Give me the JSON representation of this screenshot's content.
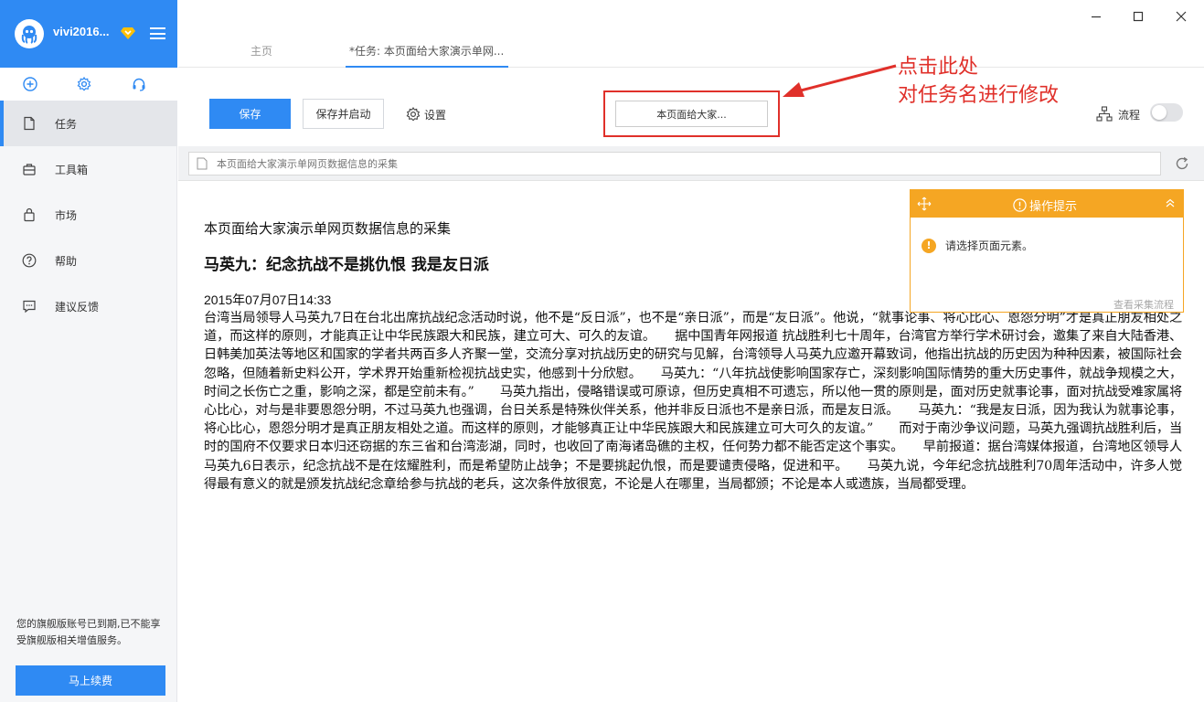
{
  "user": {
    "name": "vivi2016..."
  },
  "sidebar": {
    "quick_icons": [
      "add-circle-icon",
      "gear-icon",
      "headset-icon"
    ],
    "items": [
      {
        "label": "任务",
        "icon": "document-icon",
        "active": true
      },
      {
        "label": "工具箱",
        "icon": "toolbox-icon",
        "active": false
      },
      {
        "label": "市场",
        "icon": "bag-icon",
        "active": false
      },
      {
        "label": "帮助",
        "icon": "help-icon",
        "active": false
      },
      {
        "label": "建议反馈",
        "icon": "feedback-icon",
        "active": false
      }
    ],
    "expire_notice": "您的旗舰版账号已到期,已不能享受旗舰版相关增值服务。",
    "renew_label": "马上续费"
  },
  "tabs": [
    {
      "label": "主页",
      "active": false
    },
    {
      "label": "*任务: 本页面给大家演示单网...",
      "active": true
    }
  ],
  "toolbar": {
    "save_label": "保存",
    "save_start_label": "保存并启动",
    "settings_label": "设置",
    "task_name": "本页面给大家...",
    "flow_label": "流程"
  },
  "annotation": {
    "line1": "点击此处",
    "line2": "对任务名进行修改",
    "color": "#e0302a"
  },
  "urlbar": {
    "placeholder": "本页面给大家演示单网页数据信息的采集"
  },
  "tip": {
    "title": "操作提示",
    "message": "请选择页面元素。",
    "link": "查看采集流程"
  },
  "page": {
    "subtitle": "本页面给大家演示单网页数据信息的采集",
    "title": "马英九：纪念抗战不是挑仇恨 我是友日派",
    "date": "2015年07月07日14:33",
    "body": "台湾当局领导人马英九7日在台北出席抗战纪念活动时说，他不是“反日派”，也不是“亲日派”，而是“友日派”。他说，“就事论事、将心比心、恩怨分明”才是真正朋友相处之道，而这样的原则，才能真正让中华民族跟大和民族，建立可大、可久的友谊。　　据中国青年网报道 抗战胜利七十周年，台湾官方举行学术研讨会，邀集了来自大陆香港、日韩美加英法等地区和国家的学者共两百多人齐聚一堂，交流分享对抗战历史的研究与见解，台湾领导人马英九应邀开幕致词，他指出抗战的历史因为种种因素，被国际社会忽略，但随着新史料公开，学术界开始重新检视抗战史实，他感到十分欣慰。　　马英九：“八年抗战使影响国家存亡，深刻影响国际情势的重大历史事件，就战争规模之大，时间之长伤亡之重，影响之深，都是空前未有。”　　马英九指出，侵略错误或可原谅，但历史真相不可遗忘，所以他一贯的原则是，面对历史就事论事，面对抗战受难家属将心比心，对与是非要恩怨分明，不过马英九也强调，台日关系是特殊伙伴关系，他并非反日派也不是亲日派，而是友日派。　　马英九：“我是友日派，因为我认为就事论事，将心比心，恩怨分明才是真正朋友相处之道。而这样的原则，才能够真正让中华民族跟大和民族建立可大可久的友谊。”　　而对于南沙争议问题，马英九强调抗战胜利后，当时的国府不仅要求日本归还窃据的东三省和台湾澎湖，同时，也收回了南海诸岛礁的主权，任何势力都不能否定这个事实。　　早前报道：据台湾媒体报道，台湾地区领导人马英九6日表示，纪念抗战不是在炫耀胜利，而是希望防止战争；不是要挑起仇恨，而是要谴责侵略，促进和平。　　马英九说，今年纪念抗战胜利70周年活动中，许多人觉得最有意义的就是颁发抗战纪念章给参与抗战的老兵，这次条件放很宽，不论是人在哪里，当局都颁；不论是本人或遗族，当局都受理。"
  },
  "colors": {
    "accent": "#2f8af3",
    "tip": "#f5a623"
  }
}
